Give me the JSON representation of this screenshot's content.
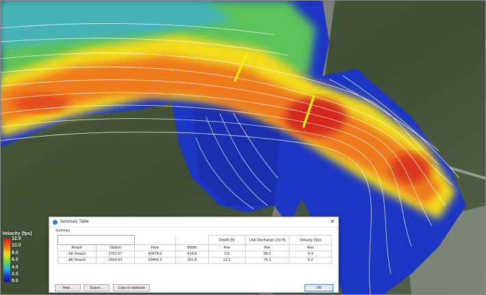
{
  "legend": {
    "title": "Velocity (fps)",
    "ticks": [
      "12.0",
      "10.0",
      "8.0",
      "6.0",
      "4.0",
      "2.0",
      "0.0"
    ],
    "colors": [
      "#d21a1a",
      "#f06b1f",
      "#f2e21a",
      "#6fd04a",
      "#28b6d6",
      "#1840c8",
      "#12128a"
    ]
  },
  "dialog": {
    "title": "Summary Table",
    "close_glyph": "✕",
    "section_label": "Summary",
    "table": {
      "header1": [
        "Depth (ft)",
        "Unit Discharge (cfs-ft)",
        "Velocity (fps)"
      ],
      "header2": [
        "Reach",
        "Station",
        "Flow",
        "Width",
        "Ave",
        "Ave",
        "Ave"
      ],
      "rows": [
        [
          "AK Reach",
          "1761.67",
          "40478.6",
          "418.8",
          "9.8",
          "98.2",
          "9.4"
        ],
        [
          "AK Reach",
          "2669.93",
          "29464.3",
          "392.8",
          "12.2",
          "76.1",
          "6.2"
        ]
      ]
    },
    "buttons": {
      "help": "Help...",
      "export": "Export...",
      "copy": "Copy to clipboard",
      "ok": "OK"
    }
  },
  "colors": {
    "section_marker": "#f4f000",
    "streamline": "#ffffff",
    "terrain": "#3a4a30"
  }
}
